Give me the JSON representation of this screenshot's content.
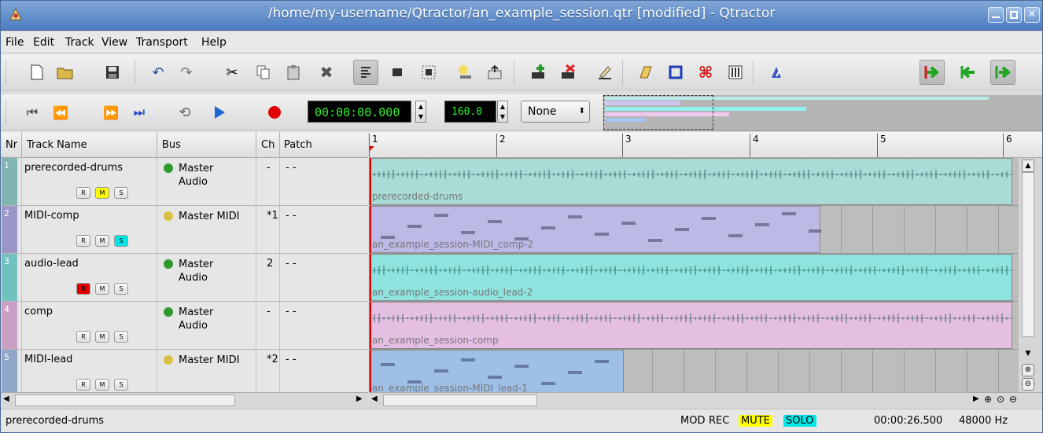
{
  "window": {
    "title": "/home/my-username/Qtractor/an_example_session.qtr [modified] - Qtractor"
  },
  "menubar": [
    "File",
    "Edit",
    "Track",
    "View",
    "Transport",
    "Help"
  ],
  "transport": {
    "time": "00:00:00.000",
    "tempo": "160.0",
    "snap": "None"
  },
  "track_headers": {
    "nr": "Nr",
    "name": "Track Name",
    "bus": "Bus",
    "ch": "Ch",
    "patch": "Patch"
  },
  "tracks": [
    {
      "nr": "1",
      "name": "prerecorded-drums",
      "bus": "Master Audio",
      "ch": "-",
      "patch": "- -",
      "color": "#7fb4b0",
      "rec": false,
      "mute": true,
      "solo": false,
      "kind": "audio"
    },
    {
      "nr": "2",
      "name": "MIDI-comp",
      "bus": "Master MIDI",
      "ch": "*1",
      "patch": "- -",
      "color": "#9a96c8",
      "rec": false,
      "mute": false,
      "solo": true,
      "kind": "midi"
    },
    {
      "nr": "3",
      "name": "audio-lead",
      "bus": "Master Audio",
      "ch": "2",
      "patch": "- -",
      "color": "#6fc2bf",
      "rec": true,
      "mute": false,
      "solo": false,
      "kind": "audio"
    },
    {
      "nr": "4",
      "name": "comp",
      "bus": "Master Audio",
      "ch": "-",
      "patch": "- -",
      "color": "#c9a0c3",
      "rec": false,
      "mute": false,
      "solo": false,
      "kind": "audio"
    },
    {
      "nr": "5",
      "name": "MIDI-lead",
      "bus": "Master MIDI",
      "ch": "*2",
      "patch": "- -",
      "color": "#8ea6c8",
      "rec": false,
      "mute": false,
      "solo": false,
      "kind": "midi"
    }
  ],
  "rms_labels": {
    "r": "R",
    "m": "M",
    "s": "S"
  },
  "ruler": [
    "1",
    "2",
    "3",
    "4",
    "5",
    "6"
  ],
  "clips": [
    {
      "label": "prerecorded-drums",
      "color": "#a9dcd6"
    },
    {
      "label": "an_example_session-MIDI_comp-2",
      "color": "#bcb9e6"
    },
    {
      "label": "an_example_session-audio_lead-2",
      "color": "#8fe3df"
    },
    {
      "label": "an_example_session-comp",
      "color": "#e4bfe2"
    },
    {
      "label": "an_example_session-MIDI_lead-1",
      "color": "#9ebfe6"
    }
  ],
  "status": {
    "track": "prerecorded-drums",
    "mod": "MOD",
    "rec": "REC",
    "mute": "MUTE",
    "solo": "SOLO",
    "length": "00:00:26.500",
    "rate": "48000 Hz"
  },
  "colors": {
    "mute": "#ffff00",
    "solo": "#00e6e6",
    "rec": "#e00000",
    "accent_green": "#2ef02e"
  }
}
